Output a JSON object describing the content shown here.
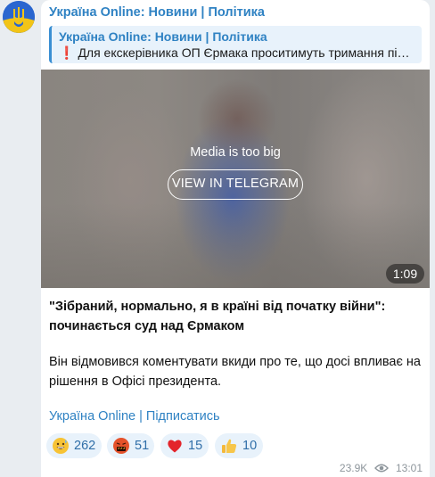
{
  "channel": {
    "name": "Україна Online: Новини | Політика"
  },
  "reply": {
    "title": "Україна Online: Новини | Політика",
    "text": "Для екскерівника ОП Єрмака проситимуть тримання під..."
  },
  "media": {
    "message": "Media is too big",
    "button_label": "VIEW IN TELEGRAM",
    "duration": "1:09"
  },
  "post": {
    "title": "\"Зібраний, нормально, я в країні від початку війни\": починається суд над Єрмаком",
    "body": "Він відмовився коментувати вкиди про те, що досі впливає на рішення в Офісі президента.",
    "link": "Україна Online | Підписатись"
  },
  "reactions": [
    {
      "emoji": "grinning-face-with-sweat-icon",
      "count": "262"
    },
    {
      "emoji": "face-with-symbols-on-mouth-icon",
      "count": "51"
    },
    {
      "emoji": "red-heart-icon",
      "count": "15"
    },
    {
      "emoji": "thumbs-up-icon",
      "count": "10"
    }
  ],
  "footer": {
    "views": "23.9K",
    "time": "13:01"
  },
  "colors": {
    "accent": "#2f82c3",
    "page_background": "#e9edf1",
    "reaction_background": "#e8f2fb"
  }
}
